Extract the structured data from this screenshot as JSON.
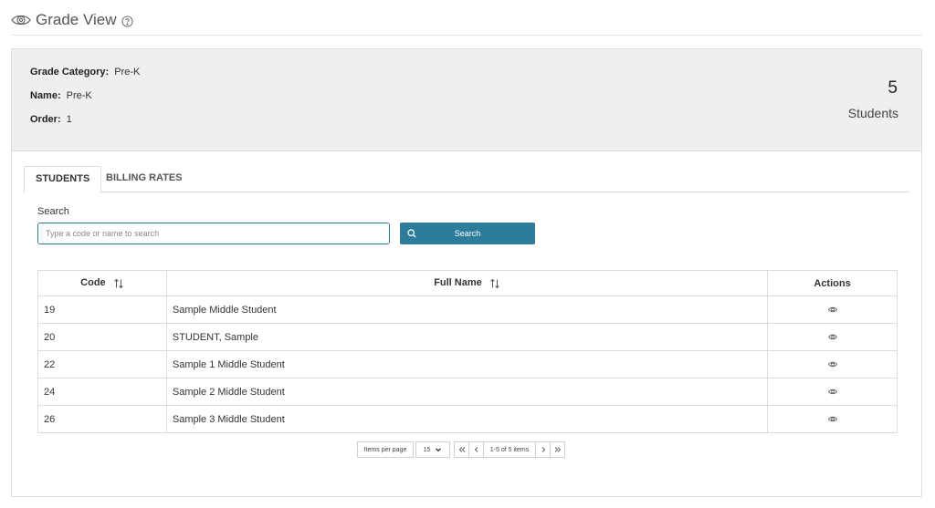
{
  "header": {
    "title": "Grade View"
  },
  "summary": {
    "grade_category_label": "Grade Category:",
    "grade_category_value": "Pre-K",
    "name_label": "Name:",
    "name_value": "Pre-K",
    "order_label": "Order:",
    "order_value": "1",
    "student_count": "5",
    "student_count_label": "Students"
  },
  "tabs": [
    {
      "label": "STUDENTS",
      "active": true
    },
    {
      "label": "BILLING RATES",
      "active": false
    }
  ],
  "search": {
    "label": "Search",
    "placeholder": "Type a code or name to search",
    "value": "",
    "button_label": "Search"
  },
  "table": {
    "columns": [
      "Code",
      "Full Name",
      "Actions"
    ],
    "rows": [
      {
        "code": "19",
        "full_name": "Sample Middle Student"
      },
      {
        "code": "20",
        "full_name": "STUDENT, Sample"
      },
      {
        "code": "22",
        "full_name": "Sample 1 Middle Student"
      },
      {
        "code": "24",
        "full_name": "Sample 2 Middle Student"
      },
      {
        "code": "26",
        "full_name": "Sample 3 Middle Student"
      }
    ]
  },
  "pager": {
    "items_per_page_label": "Items per page",
    "page_size": "15",
    "info": "1-5 of 5 items"
  },
  "colors": {
    "primary": "#2d7d9a",
    "summary_bg": "#efefef",
    "border": "#dcdcdc"
  },
  "icons": {
    "header": "eye-icon",
    "help": "help-circle-icon",
    "search": "search-icon",
    "sort": "sort-icon",
    "row_action": "view-eye-icon"
  }
}
